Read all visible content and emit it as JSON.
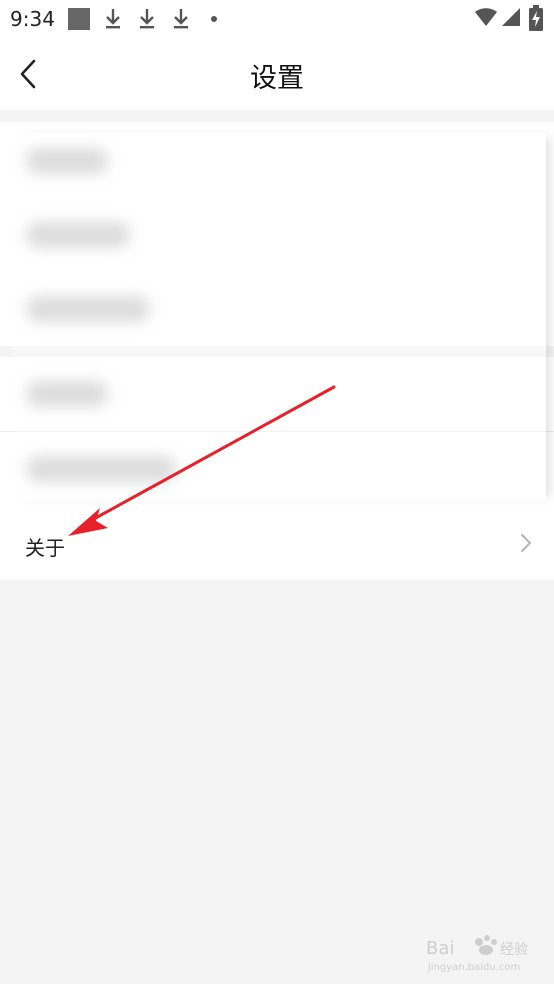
{
  "status_bar": {
    "time": "9:34",
    "icons": [
      "app-square-icon",
      "download-icon",
      "download-icon",
      "download-icon",
      "notification-dot-icon",
      "wifi-icon",
      "signal-icon",
      "battery-charging-icon"
    ]
  },
  "header": {
    "title": "设置",
    "back_icon": "chevron-left-icon"
  },
  "settings": {
    "about": {
      "label": "关于",
      "chevron_icon": "chevron-right-icon"
    }
  },
  "colors": {
    "background": "#f4f4f4",
    "surface": "#ffffff",
    "annotation_arrow": "#e8202a",
    "text": "#222222"
  }
}
